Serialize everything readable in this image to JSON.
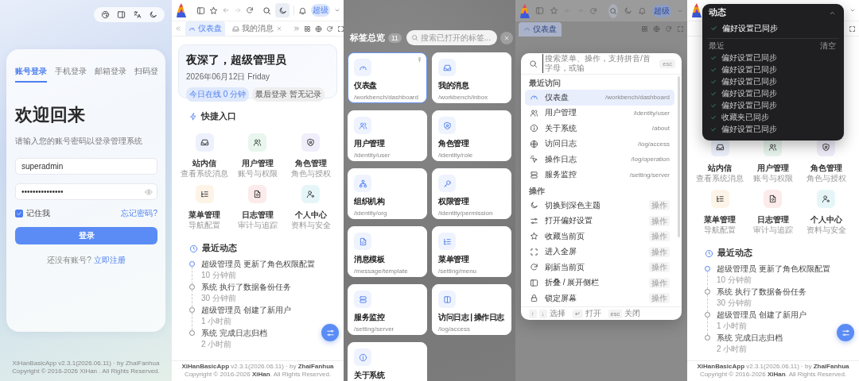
{
  "login": {
    "tabs": [
      {
        "label": "账号登录",
        "selected": true
      },
      {
        "label": "手机登录",
        "selected": false
      },
      {
        "label": "邮箱登录",
        "selected": false
      },
      {
        "label": "扫码登",
        "selected": false
      }
    ],
    "title": "欢迎回来",
    "subtitle": "请输入您的账号密码以登录管理系统",
    "username": {
      "value": "superadmin"
    },
    "password": {
      "value": "•••••••••••••••"
    },
    "remember": {
      "label": "记住我",
      "checked": true
    },
    "forgot": "忘记密码?",
    "submit": "登录",
    "register_prompt": "还没有账号?",
    "register_link": "立即注册",
    "footer": [
      "XiHanBasicApp v2.3.1(2026.06.11) · by ZhaiFanhua",
      "Copyright © 2016-2026 XiHan . All Rights Reserved."
    ]
  },
  "dashboard": {
    "user": "超级",
    "tabs": [
      {
        "label": "仪表盘",
        "selected": true,
        "closable": false
      },
      {
        "label": "我的消息",
        "selected": false,
        "closable": true
      }
    ],
    "greeting": "夜深了，超级管理员",
    "date": "2026年06月12日 Friday",
    "chips": [
      {
        "label": "今日在线 0 分钟",
        "kind": "primary"
      },
      {
        "label": "最后登录 暂无记录",
        "kind": "neutral"
      }
    ],
    "quick_title": "快捷入口",
    "quick": [
      {
        "title": "站内信",
        "subtitle": "查看系统消息",
        "color": "#edf1fd"
      },
      {
        "title": "用户管理",
        "subtitle": "账号与权限",
        "color": "#e8f6ee"
      },
      {
        "title": "角色管理",
        "subtitle": "角色与授权",
        "color": "#f1eefb"
      },
      {
        "title": "菜单管理",
        "subtitle": "导航配置",
        "color": "#fdf4e7"
      },
      {
        "title": "日志管理",
        "subtitle": "审计与追踪",
        "color": "#fcebeb"
      },
      {
        "title": "个人中心",
        "subtitle": "资料与安全",
        "color": "#e6f6f8"
      }
    ],
    "activity_title": "最近动态",
    "activity": [
      {
        "text": "超级管理员 更新了角色权限配置",
        "time": "10 分钟前",
        "active": true
      },
      {
        "text": "系统 执行了数据备份任务",
        "time": "30 分钟前",
        "active": false
      },
      {
        "text": "超级管理员 创建了新用户",
        "time": "1 小时前",
        "active": false
      },
      {
        "text": "系统 完成日志归档",
        "time": "2 小时前",
        "active": false
      }
    ],
    "footer": [
      "**XiHanBasicApp** v2.3.1(2026.06.11) · by **ZhaiFanhua**",
      "Copyright © 2016-2026 **XiHan**. All Rights Reserved."
    ]
  },
  "tab_overview": {
    "title": "标签总览",
    "count": "11",
    "search": {
      "placeholder": "搜索已打开的标签..."
    },
    "cards": [
      {
        "title": "仪表盘",
        "path": "/workbench/dashboard",
        "selected": true,
        "pinned": true
      },
      {
        "title": "我的消息",
        "path": "/workbench/inbox",
        "selected": false,
        "pinned": false
      },
      {
        "title": "用户管理",
        "path": "/identity/user",
        "selected": false,
        "pinned": false
      },
      {
        "title": "角色管理",
        "path": "/identity/role",
        "selected": false,
        "pinned": false
      },
      {
        "title": "组织机构",
        "path": "/identity/org",
        "selected": false,
        "pinned": false
      },
      {
        "title": "权限管理",
        "path": "/identity/permission",
        "selected": false,
        "pinned": false
      },
      {
        "title": "消息模板",
        "path": "/message/template",
        "selected": false,
        "pinned": false
      },
      {
        "title": "菜单管理",
        "path": "/setting/menu",
        "selected": false,
        "pinned": false
      },
      {
        "title": "服务监控",
        "path": "/setting/server",
        "selected": false,
        "pinned": false
      },
      {
        "title": "访问日志 | 操作日志",
        "path": "/log/access",
        "selected": false,
        "pinned": false
      },
      {
        "title": "关于系统",
        "selected": false,
        "pinned": false
      }
    ]
  },
  "command_palette": {
    "backdrop": {
      "user": "超级",
      "tab": "仪表盘"
    },
    "search": {
      "placeholder": "搜索菜单、操作，支持拼音/首字母，或输"
    },
    "esc": "esc",
    "groups": [
      {
        "title": "最近访问",
        "items": [
          {
            "label": "仪表盘",
            "hint": "/workbench/dashboard",
            "selected": true
          },
          {
            "label": "用户管理",
            "hint": "/identity/user",
            "selected": false
          },
          {
            "label": "关于系统",
            "hint": "/about",
            "selected": false
          },
          {
            "label": "访问日志",
            "hint": "/log/access",
            "selected": false
          },
          {
            "label": "操作日志",
            "hint": "/log/operation",
            "selected": false
          },
          {
            "label": "服务监控",
            "hint": "/setting/server",
            "selected": false
          }
        ]
      },
      {
        "title": "操作",
        "items": [
          {
            "label": "切换到深色主题",
            "hint": "操作",
            "selected": false
          },
          {
            "label": "打开偏好设置",
            "hint": "操作",
            "selected": false
          },
          {
            "label": "收藏当前页",
            "hint": "操作",
            "selected": false
          },
          {
            "label": "进入全屏",
            "hint": "操作",
            "selected": false
          },
          {
            "label": "刷新当前页",
            "hint": "操作",
            "selected": false
          },
          {
            "label": "折叠 / 展开侧栏",
            "hint": "操作",
            "selected": false
          },
          {
            "label": "锁定屏幕",
            "hint": "操作",
            "selected": false
          }
        ]
      }
    ],
    "footer": [
      {
        "keys": [
          "↑",
          "↓"
        ],
        "label": "选择"
      },
      {
        "keys": [
          "↵"
        ],
        "label": "打开"
      },
      {
        "keys": [
          "esc"
        ],
        "label": "关闭"
      }
    ]
  },
  "notifications": {
    "title": "动态",
    "expanded": true,
    "current": "偏好设置已同步",
    "recent_title": "最近",
    "clear": "清空",
    "items": [
      "偏好设置已同步",
      "偏好设置已同步",
      "偏好设置已同步",
      "偏好设置已同步",
      "偏好设置已同步",
      "收藏夹已同步",
      "偏好设置已同步"
    ]
  },
  "dashboard_under_notifications": {
    "quick": [
      {
        "title": "站内信",
        "subtitle": "查看系统消息",
        "color": "#edf1fd"
      },
      {
        "title": "用户管理",
        "subtitle": "账号与权限",
        "color": "#e8f6ee"
      },
      {
        "title": "角色管理",
        "subtitle": "角色与授权",
        "color": "#f1eefb"
      },
      {
        "title": "菜单管理",
        "subtitle": "导航配置",
        "color": "#fdf4e7"
      },
      {
        "title": "日志管理",
        "subtitle": "审计与追踪",
        "color": "#fcebeb"
      },
      {
        "title": "个人中心",
        "subtitle": "资料与安全",
        "color": "#e6f6f8"
      }
    ],
    "activity_title": "最近动态",
    "activity": [
      {
        "text": "超级管理员 更新了角色权限配置",
        "time": "10 分钟前",
        "active": true
      },
      {
        "text": "系统 执行了数据备份任务",
        "time": "30 分钟前",
        "active": false
      },
      {
        "text": "超级管理员 创建了新用户",
        "time": "1 小时前",
        "active": false
      },
      {
        "text": "系统 完成日志归档",
        "time": "2 小时前",
        "active": false
      }
    ],
    "footer": [
      "**XiHanBasicApp** v2.3.1(2026.06.11) · by **ZhaiFanhua**",
      "Copyright © 2016-2026 **XiHan**. All Rights Reserved."
    ]
  }
}
